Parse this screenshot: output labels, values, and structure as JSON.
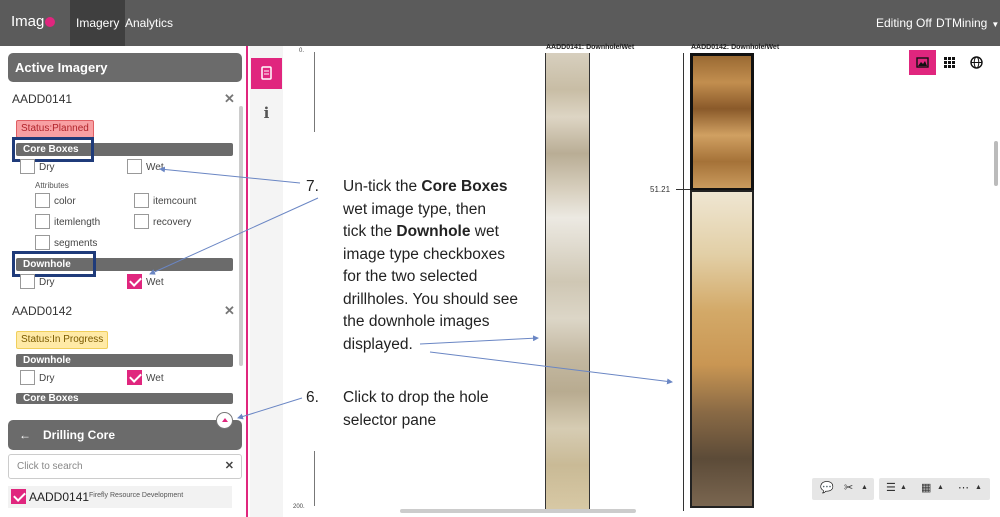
{
  "app": {
    "logo_text": "Imag",
    "tabs": [
      {
        "label": "Imagery",
        "active": true
      },
      {
        "label": "Analytics",
        "active": false
      }
    ],
    "editing_status": "Editing Off",
    "account_name": "DTMining",
    "accent_color": "#e0267e"
  },
  "sidebar": {
    "title": "Active Imagery",
    "holes": [
      {
        "name": "AADD0141",
        "status": "Status:Planned",
        "types": [
          {
            "label": "Core Boxes",
            "dry_label": "Dry",
            "wet_label": "Wet",
            "dry_checked": false,
            "wet_checked": false
          },
          {
            "label": "Downhole",
            "dry_label": "Dry",
            "wet_label": "Wet",
            "dry_checked": false,
            "wet_checked": true
          }
        ],
        "attributes_label": "Attributes",
        "attributes": [
          {
            "label": "color",
            "checked": false
          },
          {
            "label": "itemcount",
            "checked": false
          },
          {
            "label": "itemlength",
            "checked": false
          },
          {
            "label": "recovery",
            "checked": false
          },
          {
            "label": "segments",
            "checked": false
          }
        ]
      },
      {
        "name": "AADD0142",
        "status": "Status:In Progress",
        "types": [
          {
            "label": "Downhole",
            "dry_label": "Dry",
            "wet_label": "Wet",
            "dry_checked": false,
            "wet_checked": true
          },
          {
            "label": "Core Boxes"
          }
        ]
      }
    ],
    "selector": {
      "title": "Drilling Core",
      "search_placeholder": "Click to search",
      "results": [
        {
          "name": "AADD0141",
          "company": "Firefly Resource Development",
          "checked": true
        }
      ]
    }
  },
  "viewer": {
    "columns": [
      {
        "title": "AADD0141: Downhole/Wet"
      },
      {
        "title": "AADD0142: Downhole/Wet"
      }
    ],
    "ruler_top_label": "0.",
    "ruler_bottom_label": "200.",
    "depth_marker": "51.21",
    "view_modes": [
      "image-icon",
      "grid-icon",
      "globe-icon"
    ],
    "active_view": "image-icon"
  },
  "annotations": [
    {
      "number": "7.",
      "lines": [
        [
          "Un-tick the ",
          {
            "b": "Core Boxes"
          }
        ],
        [
          "wet image type, then"
        ],
        [
          "tick the ",
          {
            "b": "Downhole"
          },
          " wet"
        ],
        [
          "image type checkboxes"
        ],
        [
          "for the two selected"
        ],
        [
          "drillholes. You should see"
        ],
        [
          "the downhole images"
        ],
        [
          "displayed."
        ]
      ]
    },
    {
      "number": "6.",
      "lines": [
        [
          "Click to drop the hole"
        ],
        [
          "selector pane"
        ]
      ]
    }
  ]
}
